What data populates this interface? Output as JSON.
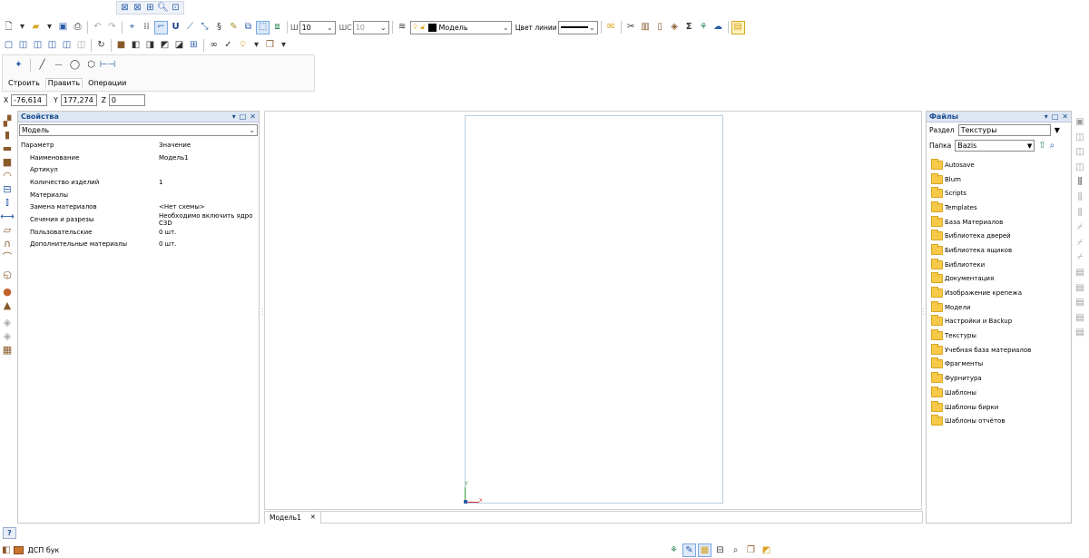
{
  "top_toolbar": {
    "lineweight_label": "Ш",
    "lineweight_value": "10",
    "ws_label": "ШС",
    "ws_value": "10",
    "layer_value": "Модель",
    "line_color_label": "Цвет линии"
  },
  "build_panel": {
    "tabs": [
      "Строить",
      "Править",
      "Операции"
    ]
  },
  "coords": {
    "x_label": "X",
    "x_value": "-76,614",
    "y_label": "Y",
    "y_value": "177,274",
    "z_label": "Z",
    "z_value": "0"
  },
  "properties": {
    "title": "Свойства",
    "selector_value": "Модель",
    "col_param": "Параметр",
    "col_value": "Значение",
    "rows": [
      {
        "k": "Наименование",
        "v": "Модель1"
      },
      {
        "k": "Артикул",
        "v": ""
      },
      {
        "k": "Количество изделий",
        "v": "1"
      },
      {
        "k": "Материалы",
        "v": ""
      },
      {
        "k": "Замена материалов",
        "v": "<Нет схемы>"
      },
      {
        "k": "Сечения и разрезы",
        "v": "Необходимо включить ядро C3D"
      },
      {
        "k": "Пользовательские",
        "v": "0 шт."
      },
      {
        "k": "Дополнительные материалы",
        "v": "0 шт."
      }
    ]
  },
  "files": {
    "title": "Файлы",
    "section_label": "Раздел",
    "section_value": "Текстуры",
    "folder_label": "Папка",
    "folder_value": "Bazis",
    "items": [
      "Autosave",
      "Blum",
      "Scripts",
      "Templates",
      "База Материалов",
      "Библиотека дверей",
      "Библиотека ящиков",
      "Библиотеки",
      "Документация",
      "Изображение крепежа",
      "Модели",
      "Настройки и Backup",
      "Текстуры",
      "Учебная база материалов",
      "Фрагменты",
      "Фурнитура",
      "Шаблоны",
      "Шаблоны бирки",
      "Шаблоны отчётов"
    ]
  },
  "viewport": {
    "tab_label": "Модель1",
    "tab_close": "✕",
    "axis_y": "Y",
    "axis_x": "x"
  },
  "status": {
    "help": "?",
    "material": "ДСП бук"
  },
  "colors": {
    "accent": "#1d4f91",
    "panel_header": "#dde6f3",
    "folder": "#f7c948"
  }
}
